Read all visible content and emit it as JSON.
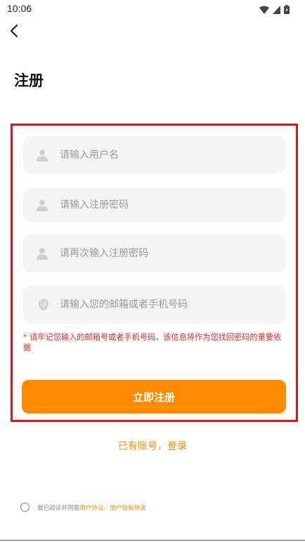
{
  "status_bar": {
    "time": "10:06",
    "icons": [
      "wifi-icon",
      "signal-icon",
      "battery-icon"
    ]
  },
  "header": {
    "back_icon": "chevron-left-icon",
    "title": "注册"
  },
  "form": {
    "username": {
      "placeholder": "请输入用户名",
      "value": "",
      "icon": "user-icon"
    },
    "password": {
      "placeholder": "请输入注册密码",
      "value": "",
      "icon": "user-icon"
    },
    "password_confirm": {
      "placeholder": "请再次输入注册密码",
      "value": "",
      "icon": "user-icon"
    },
    "contact": {
      "placeholder": "请输入您的邮箱或者手机号码",
      "value": "",
      "icon": "shield-icon"
    },
    "hint": "* 请牢记您输入的邮箱号或者手机号码，该信息将作为您找回密码的重要依据",
    "submit_label": "立即注册"
  },
  "login_link": "已有账号，登录",
  "agreement": {
    "prefix": "我已阅读并同意",
    "links": "用户协议、用户隐私协议"
  },
  "colors": {
    "accent": "#ff8a00",
    "highlight_border": "#d9141b",
    "hint_text": "#e42a2a",
    "field_bg": "#f4f4f4"
  }
}
